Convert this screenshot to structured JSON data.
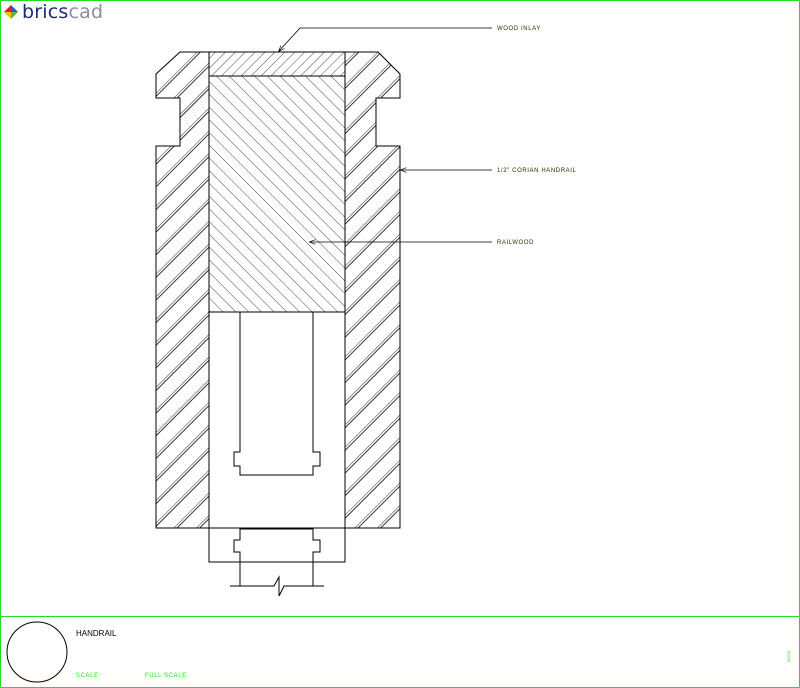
{
  "logo": {
    "part1": "brics",
    "part2": "cad",
    "icon": "bricscad-logo-icon"
  },
  "callouts": {
    "wood_inlay": "WOOD INLAY",
    "corian_handrail": "1/2\" CORIAN HANDRAIL",
    "rail_wood": "RAILWOOD"
  },
  "title_block": {
    "title": "HANDRAIL",
    "scale_label": "SCALE:",
    "scale_value": "FULL SCALE",
    "code": "06200"
  },
  "colors": {
    "border": "#22dd22",
    "linework": "#000000",
    "callout_text": "#303000",
    "logo_dark": "#1e2a78",
    "logo_light": "#8a8f99"
  }
}
